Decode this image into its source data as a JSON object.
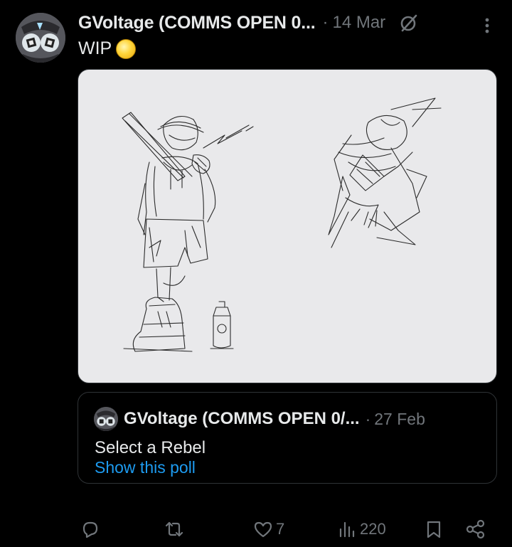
{
  "post": {
    "author": "GVoltage (COMMS OPEN 0...",
    "separator": "·",
    "time": "14 Mar",
    "text": "WIP",
    "icons": {
      "avatar": "avatar-image",
      "grok": "grok-icon",
      "more": "more-vertical-icon",
      "emoji": "coin-emoji-icon"
    },
    "media": {
      "description_icon": "sketch-image"
    }
  },
  "quote": {
    "author": "GVoltage (COMMS OPEN 0/...",
    "separator": "·",
    "time": "27 Feb",
    "text": "Select a Rebel",
    "link": "Show this poll"
  },
  "actions": {
    "reply": {
      "icon": "reply-icon",
      "count": ""
    },
    "repost": {
      "icon": "repost-icon",
      "count": ""
    },
    "like": {
      "icon": "heart-icon",
      "count": "7"
    },
    "views": {
      "icon": "views-icon",
      "count": "220"
    },
    "bookmark": {
      "icon": "bookmark-icon",
      "count": ""
    },
    "share": {
      "icon": "share-icon",
      "count": ""
    }
  },
  "colors": {
    "background": "#000000",
    "text_primary": "#e7e9ea",
    "text_secondary": "#71767b",
    "link": "#1d9bf0",
    "border": "#2f3336",
    "media_bg": "#e9e9eb"
  }
}
